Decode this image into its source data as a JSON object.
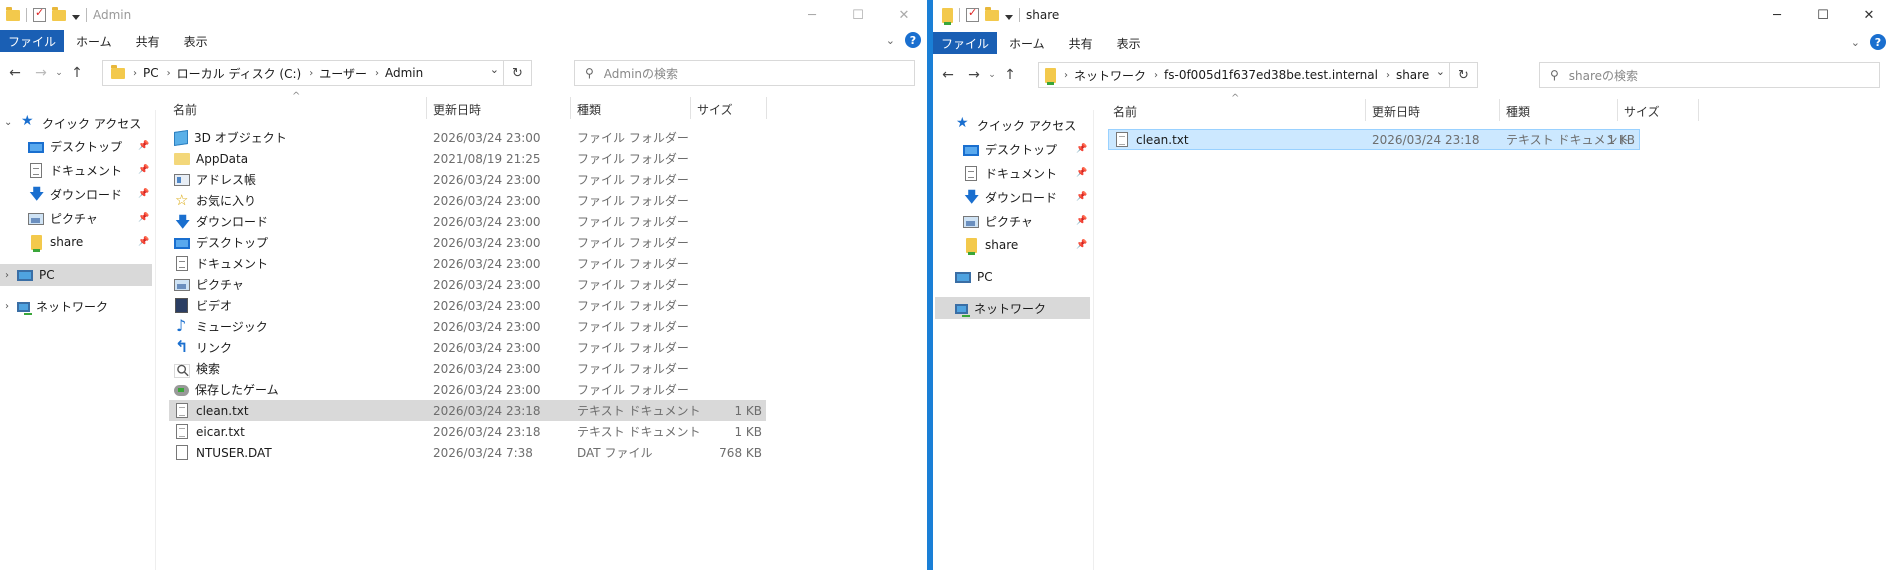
{
  "left": {
    "title": "Admin",
    "tabs": [
      "ファイル",
      "ホーム",
      "共有",
      "表示"
    ],
    "breadcrumb": [
      "PC",
      "ローカル ディスク (C:)",
      "ユーザー",
      "Admin"
    ],
    "search_placeholder": "Adminの検索",
    "nav": {
      "quick_access": "クイック アクセス",
      "desktop": "デスクトップ",
      "documents": "ドキュメント",
      "downloads": "ダウンロード",
      "pictures": "ピクチャ",
      "share": "share",
      "pc": "PC",
      "network": "ネットワーク"
    },
    "columns": {
      "name": "名前",
      "date": "更新日時",
      "type": "種類",
      "size": "サイズ"
    },
    "files": [
      {
        "icon": "3d-objects-icon",
        "name": "3D オブジェクト",
        "date": "2026/03/24 23:00",
        "type": "ファイル フォルダー",
        "size": ""
      },
      {
        "icon": "folder-icon",
        "name": "AppData",
        "date": "2021/08/19 21:25",
        "type": "ファイル フォルダー",
        "size": ""
      },
      {
        "icon": "address-book-icon",
        "name": "アドレス帳",
        "date": "2026/03/24 23:00",
        "type": "ファイル フォルダー",
        "size": ""
      },
      {
        "icon": "favorites-icon",
        "name": "お気に入り",
        "date": "2026/03/24 23:00",
        "type": "ファイル フォルダー",
        "size": ""
      },
      {
        "icon": "download-icon",
        "name": "ダウンロード",
        "date": "2026/03/24 23:00",
        "type": "ファイル フォルダー",
        "size": ""
      },
      {
        "icon": "desktop-icon",
        "name": "デスクトップ",
        "date": "2026/03/24 23:00",
        "type": "ファイル フォルダー",
        "size": ""
      },
      {
        "icon": "document-icon",
        "name": "ドキュメント",
        "date": "2026/03/24 23:00",
        "type": "ファイル フォルダー",
        "size": ""
      },
      {
        "icon": "picture-icon",
        "name": "ピクチャ",
        "date": "2026/03/24 23:00",
        "type": "ファイル フォルダー",
        "size": ""
      },
      {
        "icon": "video-icon",
        "name": "ビデオ",
        "date": "2026/03/24 23:00",
        "type": "ファイル フォルダー",
        "size": ""
      },
      {
        "icon": "music-icon",
        "name": "ミュージック",
        "date": "2026/03/24 23:00",
        "type": "ファイル フォルダー",
        "size": ""
      },
      {
        "icon": "link-icon",
        "name": "リンク",
        "date": "2026/03/24 23:00",
        "type": "ファイル フォルダー",
        "size": ""
      },
      {
        "icon": "search-icon",
        "name": "検索",
        "date": "2026/03/24 23:00",
        "type": "ファイル フォルダー",
        "size": ""
      },
      {
        "icon": "saved-games-icon",
        "name": "保存したゲーム",
        "date": "2026/03/24 23:00",
        "type": "ファイル フォルダー",
        "size": ""
      },
      {
        "icon": "text-file-icon",
        "name": "clean.txt",
        "date": "2026/03/24 23:18",
        "type": "テキスト ドキュメント",
        "size": "1 KB"
      },
      {
        "icon": "text-file-icon",
        "name": "eicar.txt",
        "date": "2026/03/24 23:18",
        "type": "テキスト ドキュメント",
        "size": "1 KB"
      },
      {
        "icon": "file-icon",
        "name": "NTUSER.DAT",
        "date": "2026/03/24 7:38",
        "type": "DAT ファイル",
        "size": "768 KB"
      }
    ],
    "selected_row": 13
  },
  "right": {
    "title": "share",
    "tabs": [
      "ファイル",
      "ホーム",
      "共有",
      "表示"
    ],
    "breadcrumb": [
      "ネットワーク",
      "fs-0f005d1f637ed38be.test.internal",
      "share"
    ],
    "search_placeholder": "shareの検索",
    "nav": {
      "quick_access": "クイック アクセス",
      "desktop": "デスクトップ",
      "documents": "ドキュメント",
      "downloads": "ダウンロード",
      "pictures": "ピクチャ",
      "share": "share",
      "pc": "PC",
      "network": "ネットワーク"
    },
    "columns": {
      "name": "名前",
      "date": "更新日時",
      "type": "種類",
      "size": "サイズ"
    },
    "files": [
      {
        "icon": "text-file-icon",
        "name": "clean.txt",
        "date": "2026/03/24 23:18",
        "type": "テキスト ドキュメント",
        "size": "1 KB"
      }
    ]
  },
  "colors": {
    "accent": "#1a5fb4",
    "divider": "#1a7fd6",
    "selection_gray": "#d9d9d9",
    "selection_blue": "#cce8ff"
  }
}
